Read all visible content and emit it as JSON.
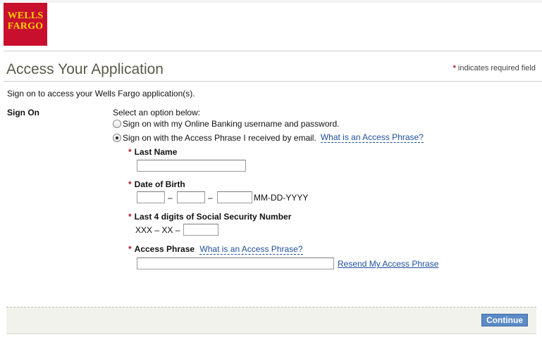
{
  "brand": {
    "logo_line1": "WELLS",
    "logo_line2": "FARGO"
  },
  "page": {
    "title": "Access Your Application",
    "required_note": "indicates required field",
    "required_marker": "*",
    "intro": "Sign on to access your Wells Fargo application(s)."
  },
  "signon": {
    "label": "Sign On",
    "prompt": "Select an option below:",
    "options": [
      {
        "label": "Sign on with my Online Banking username and password.",
        "selected": false
      },
      {
        "label": "Sign on with the Access Phrase I received by email.",
        "selected": true
      }
    ],
    "help_link": "What is an Access Phrase?"
  },
  "fields": {
    "last_name": {
      "label": "Last Name",
      "value": ""
    },
    "dob": {
      "label": "Date of Birth",
      "sep": "–",
      "format": "MM-DD-YYYY",
      "month": "",
      "day": "",
      "year": ""
    },
    "ssn": {
      "label": "Last 4 digits of Social Security Number",
      "prefix": "XXX – XX –",
      "value": ""
    },
    "access_phrase": {
      "label": "Access Phrase",
      "help_link": "What is an Access Phrase?",
      "value": "",
      "resend_link": "Resend My Access Phrase"
    }
  },
  "footer": {
    "continue_label": "Continue"
  },
  "colors": {
    "brand_red": "#c8102e",
    "brand_gold": "#ffd100",
    "link_blue": "#1f4fa0",
    "button_blue": "#5b8ac7",
    "required_red": "#b1172c"
  }
}
